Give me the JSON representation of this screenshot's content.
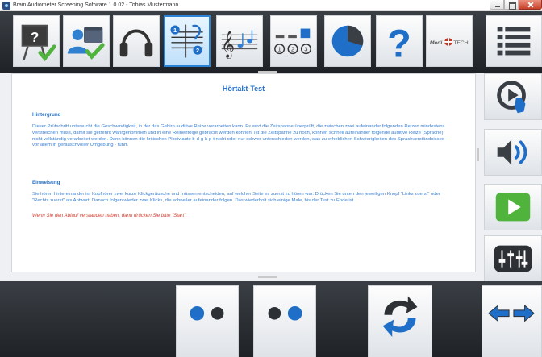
{
  "window": {
    "title": "Brain Audiometer Screening Software 1.0.02 - Tobias Mustermann"
  },
  "toolbar": {
    "items": [
      {
        "name": "presentation-check",
        "icon": "presentation-board-check-icon"
      },
      {
        "name": "patient-records",
        "icon": "user-folder-check-icon"
      },
      {
        "name": "headphones",
        "icon": "headphones-icon"
      },
      {
        "name": "hearing-test-steps",
        "icon": "ear-staff-numbered-icon",
        "active": true
      },
      {
        "name": "music-notes",
        "icon": "treble-clef-notes-icon"
      },
      {
        "name": "sequence",
        "icon": "numbered-sequence-icon",
        "numbers": [
          "1",
          "2",
          "3"
        ]
      },
      {
        "name": "results-chart",
        "icon": "pie-chart-icon"
      },
      {
        "name": "help",
        "icon": "question-mark-icon",
        "label": "?"
      },
      {
        "name": "meditech-logo",
        "icon": "meditech-logo",
        "text_left": "Medi",
        "text_right": "TECH"
      }
    ],
    "menu": {
      "icon": "list-menu-icon"
    }
  },
  "content": {
    "title": "Hörtakt-Test",
    "sections": [
      {
        "heading": "Hintergrund",
        "text": "Dieser Prüfschritt untersucht die Geschwindigkeit, in der das Gehirn auditive Reize verarbeiten kann. Es wird die Zeitspanne überprüft, die zwischen zwei aufeinander folgenden Reizen mindestens verstreichen muss, damit sie getrennt wahrgenommen und in eine Reihenfolge gebracht werden können. Ist die Zeitspanne zu hoch, können schnell aufeinander folgende auditive Reize (Sprache) nicht vollständig verarbeitet werden. Dann können die kritischen Plosivlaute b-d-g-k-p-t nicht oder nur schwer unterschieden werden, was zu erheblichen Schwierigkeiten des Sprachverständnisses – vor allem in geräuschvoller Umgebung - führt."
      },
      {
        "heading": "Einweisung",
        "text": "Sie hören hintereinander im Kopfhörer zwei kurze Klickgeräusche und müssen entscheiden, auf welcher Seite es zuerst zu hören war. Drücken Sie unten den jeweiligen Knopf \"Links zuerst\" oder \"Rechts zuerst\" als Antwort. Danach folgen wieder zwei Klicks, die schneller aufeinander folgen. Das wiederholt sich einige Male, bis der Test zu Ende ist."
      }
    ],
    "note": "Wenn Sie den Ablauf verstanden haben, dann drücken Sie bitte \"Start\"."
  },
  "sidebar": {
    "items": [
      {
        "name": "play-demo",
        "icon": "play-hand-touch-icon"
      },
      {
        "name": "volume",
        "icon": "speaker-volume-icon"
      },
      {
        "name": "start",
        "icon": "green-play-icon"
      },
      {
        "name": "mixer",
        "icon": "equalizer-sliders-icon"
      }
    ]
  },
  "bottom": {
    "items": [
      {
        "name": "left-first",
        "icon": "two-dots-left-icon"
      },
      {
        "name": "right-first",
        "icon": "two-dots-right-icon"
      },
      {
        "name": "repeat",
        "icon": "refresh-arrows-icon"
      },
      {
        "name": "navigate",
        "icon": "back-forward-arrows-icon"
      }
    ]
  },
  "colors": {
    "accent_blue": "#2b73c8",
    "text_blue": "#3a7fd1",
    "note_red": "#d63b2f",
    "check_green": "#4fb33c",
    "toolbar_dark": "#2a2e33"
  }
}
